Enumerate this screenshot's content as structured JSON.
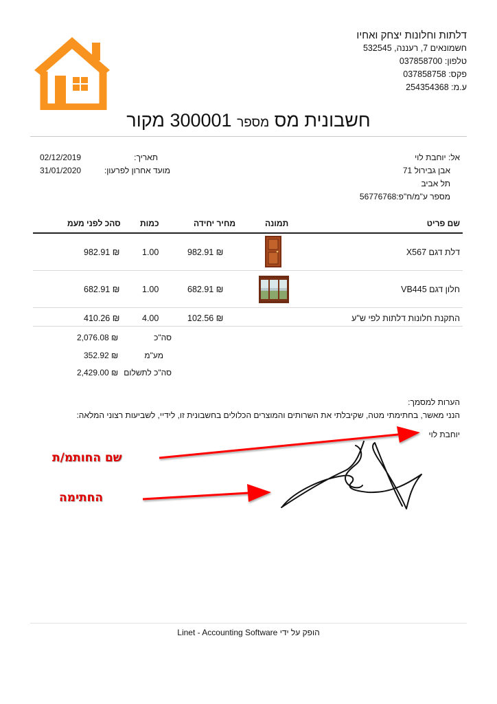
{
  "company": {
    "name": "דלתות וחלונות יצחק ואחיו",
    "address": "חשמונאים 7, רעננה, 532545",
    "phone": "טלפון: 037858700",
    "fax": "פקס: 037858758",
    "vat": "ע.מ: 254354368",
    "logo_color": "#f7931e"
  },
  "title": {
    "main": "חשבונית מס",
    "number_label": "מספר",
    "number": "300001",
    "suffix": "מקור"
  },
  "bill_to": {
    "name": "אל: יוחבת לוי",
    "street": "אבן גבירול 71",
    "city": "תל אביב",
    "tax_id": "מספר ע\"מ/ח\"פ:56776768"
  },
  "meta": {
    "date_label": "תאריך:",
    "date": "02/12/2019",
    "due_label": "מועד אחרון לפרעון:",
    "due": "31/01/2020"
  },
  "table": {
    "headers": {
      "item": "שם פריט",
      "image": "תמונה",
      "unit_price": "מחיר יחידה",
      "qty": "כמות",
      "total": "סהכ לפני מעמ"
    },
    "rows": [
      {
        "item": "דלת דגם X567",
        "unit_price": "982.91 ₪",
        "qty": "1.00",
        "total": "982.91 ₪",
        "image": "door-image"
      },
      {
        "item": "חלון דגם VB445",
        "unit_price": "682.91 ₪",
        "qty": "1.00",
        "total": "682.91 ₪",
        "image": "window-image"
      },
      {
        "item": "התקנת חלונות דלתות לפי ש\"ע",
        "unit_price": "102.56 ₪",
        "qty": "4.00",
        "total": "410.26 ₪",
        "image": ""
      }
    ]
  },
  "totals": [
    {
      "label": "סה\"כ",
      "value": "2,076.08 ₪"
    },
    {
      "label": "מע\"מ",
      "value": "352.92 ₪"
    },
    {
      "label": "סה\"כ לתשלום",
      "value": "2,429.00 ₪"
    }
  ],
  "notes": {
    "label": "הערות למסמך:",
    "text": "הנני מאשר, בחתימתי מטה, שקיבלתי את השרותים והמוצרים הכלולים בחשבונית זו, לידיי, לשביעות רצוני המלאה:",
    "signer": "יוחבת לוי"
  },
  "annotations": {
    "signer_name": "שם החותמ/ת",
    "signature": "החתימה",
    "color": "#ff0000"
  },
  "footer": {
    "prefix": "הופק על ידי",
    "brand": "Linet - Accounting Software"
  }
}
